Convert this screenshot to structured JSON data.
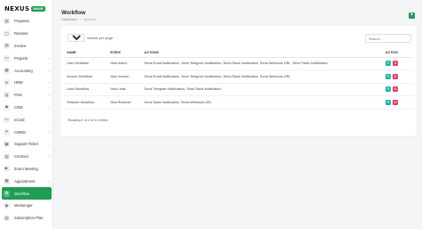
{
  "app": {
    "logo_text": "NEXUS",
    "logo_badge": "WAVE"
  },
  "sidebar": {
    "items": [
      {
        "label": "Proposal",
        "icon": "document-icon",
        "chevron": false,
        "active": false
      },
      {
        "label": "Retainer",
        "icon": "file-icon",
        "chevron": false,
        "active": false
      },
      {
        "label": "Invoice",
        "icon": "invoice-icon",
        "chevron": false,
        "active": false
      },
      {
        "label": "Projects",
        "icon": "folder-icon",
        "chevron": true,
        "active": false
      },
      {
        "label": "Accounting",
        "icon": "calculator-icon",
        "chevron": true,
        "active": false
      },
      {
        "label": "HRM",
        "icon": "users-icon",
        "chevron": true,
        "active": false
      },
      {
        "label": "POS",
        "icon": "cart-icon",
        "chevron": true,
        "active": false
      },
      {
        "label": "CRM",
        "icon": "handshake-icon",
        "chevron": true,
        "active": false
      },
      {
        "label": "eCard",
        "icon": "card-icon",
        "chevron": true,
        "active": false
      },
      {
        "label": "CMMS",
        "icon": "wrench-icon",
        "chevron": true,
        "active": false
      },
      {
        "label": "Support Ticket",
        "icon": "ticket-icon",
        "chevron": true,
        "active": false
      },
      {
        "label": "Contract",
        "icon": "contract-icon",
        "chevron": true,
        "active": false
      },
      {
        "label": "Zoom Meeting",
        "icon": "video-icon",
        "chevron": false,
        "active": false
      },
      {
        "label": "Appointment",
        "icon": "calendar-icon",
        "chevron": true,
        "active": false
      },
      {
        "label": "Workflow",
        "icon": "workflow-icon",
        "chevron": false,
        "active": true
      },
      {
        "label": "Messenger",
        "icon": "chat-icon",
        "chevron": false,
        "active": false
      },
      {
        "label": "Subscription Plan",
        "icon": "plan-icon",
        "chevron": false,
        "active": false
      }
    ]
  },
  "header": {
    "title": "Workflow",
    "breadcrumb": [
      "Dashboard",
      "Workflow"
    ],
    "add_label": "+"
  },
  "table": {
    "page_size_value": "10",
    "page_size_label": "entries per page",
    "search_placeholder": "Search...",
    "columns": [
      "NAME",
      "EVENT",
      "ACTIONS",
      "ACTION"
    ],
    "rows": [
      {
        "name": "User Workflow",
        "event": "New Users",
        "actions": "Send Email Notification, Send Telegram Notification, Send Slack Notification, Send Webhook URL, Send Twilio Notification"
      },
      {
        "name": "Invoice Workflow",
        "event": "New Invoice",
        "actions": "Send Email Notification, Send Telegram Notification, Send Slack Notification, Send Webhook URL"
      },
      {
        "name": "Lead Workflow",
        "event": "New Lead",
        "actions": "Send Telegram Notification, Send Slack Notification"
      },
      {
        "name": "Retainer Workflow",
        "event": "New Retainer",
        "actions": "Send Slack Notification, Send Webhook URL"
      }
    ],
    "showing": "Showing 1 to 4 of 4 entries",
    "edit_icon": "✎",
    "delete_icon": "🗑"
  },
  "colors": {
    "primary": "#1f9d55",
    "edit": "#1fb5a3",
    "delete": "#e0406a"
  }
}
